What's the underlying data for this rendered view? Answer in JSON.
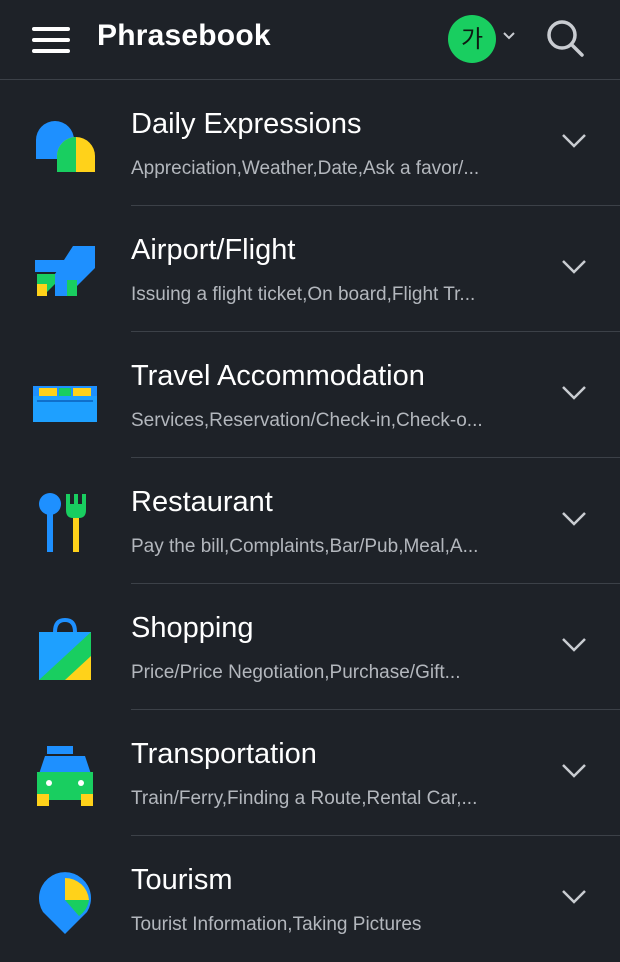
{
  "header": {
    "title": "Phrasebook",
    "language_glyph": "가",
    "menu_icon": "hamburger-menu-icon",
    "search_icon": "search-icon"
  },
  "colors": {
    "background": "#1e2228",
    "divider": "#3c4148",
    "accent_green": "#19ce60",
    "blue": "#1e90ff",
    "yellow": "#ffd21a",
    "subtitle": "#b3b7bd"
  },
  "categories": [
    {
      "title": "Daily Expressions",
      "subtitle": "Appreciation,Weather,Date,Ask a favor/...",
      "icon": "speech-bubbles-icon"
    },
    {
      "title": "Airport/Flight",
      "subtitle": "Issuing a flight ticket,On board,Flight Tr...",
      "icon": "airplane-icon"
    },
    {
      "title": "Travel Accommodation",
      "subtitle": "Services,Reservation/Check-in,Check-o...",
      "icon": "bed-icon"
    },
    {
      "title": "Restaurant",
      "subtitle": "Pay the bill,Complaints,Bar/Pub,Meal,A...",
      "icon": "spoon-fork-icon"
    },
    {
      "title": "Shopping",
      "subtitle": "Price/Price Negotiation,Purchase/Gift...",
      "icon": "shopping-bag-icon"
    },
    {
      "title": "Transportation",
      "subtitle": "Train/Ferry,Finding a Route,Rental Car,...",
      "icon": "taxi-icon"
    },
    {
      "title": "Tourism",
      "subtitle": "Tourist Information,Taking Pictures",
      "icon": "map-pin-icon"
    }
  ]
}
